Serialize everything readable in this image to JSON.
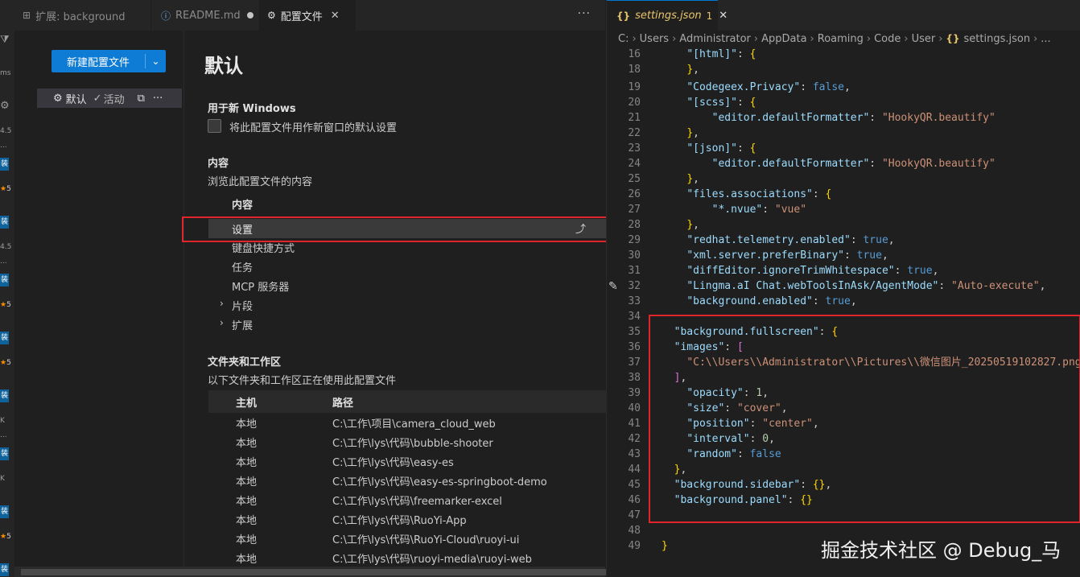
{
  "activity_bar": {
    "items": [
      "ms",
      "4.5",
      "...",
      "4.5",
      "...",
      "5",
      "5",
      "5",
      "5",
      "K",
      "...",
      "K",
      "5"
    ],
    "blue_label": "装"
  },
  "left_tabs": [
    {
      "icon": "extension-icon",
      "label": "扩展: background"
    },
    {
      "icon": "info-icon",
      "label": "README.md"
    },
    {
      "icon": "settings-profile-icon",
      "label": "配置文件"
    }
  ],
  "profiles": {
    "new_profile_label": "新建配置文件",
    "row": {
      "name": "默认",
      "status": "活动"
    }
  },
  "profile_detail": {
    "title": "默认",
    "new_window_heading": "用于新 Windows",
    "new_window_label": "将此配置文件用作新窗口的默认设置",
    "contents_heading": "内容",
    "contents_desc": "浏览此配置文件的内容",
    "items": [
      "内容",
      "设置",
      "键盘快捷方式",
      "任务",
      "MCP 服务器",
      "片段",
      "扩展"
    ],
    "folders_heading": "文件夹和工作区",
    "folders_desc": "以下文件夹和工作区正在使用此配置文件",
    "table_headers": [
      "主机",
      "路径"
    ],
    "table_rows": [
      [
        "本地",
        "C:\\工作\\项目\\camera_cloud_web"
      ],
      [
        "本地",
        "C:\\工作\\lys\\代码\\bubble-shooter"
      ],
      [
        "本地",
        "C:\\工作\\lys\\代码\\easy-es"
      ],
      [
        "本地",
        "C:\\工作\\lys\\代码\\easy-es-springboot-demo"
      ],
      [
        "本地",
        "C:\\工作\\lys\\代码\\freemarker-excel"
      ],
      [
        "本地",
        "C:\\工作\\lys\\代码\\RuoYi-App"
      ],
      [
        "本地",
        "C:\\工作\\lys\\代码\\RuoYi-Cloud\\ruoyi-ui"
      ],
      [
        "本地",
        "C:\\工作\\lys\\代码\\ruoyi-media\\ruoyi-web"
      ]
    ]
  },
  "right_tab": {
    "name": "settings.json",
    "problems": "1"
  },
  "breadcrumb": [
    "C:",
    "Users",
    "Administrator",
    "AppData",
    "Roaming",
    "Code",
    "User",
    "settings.json",
    "..."
  ],
  "watermark": "掘金技术社区 @ Debug_马",
  "colors": {
    "accent": "#0e7bd4",
    "highlight": "#e0252b"
  }
}
